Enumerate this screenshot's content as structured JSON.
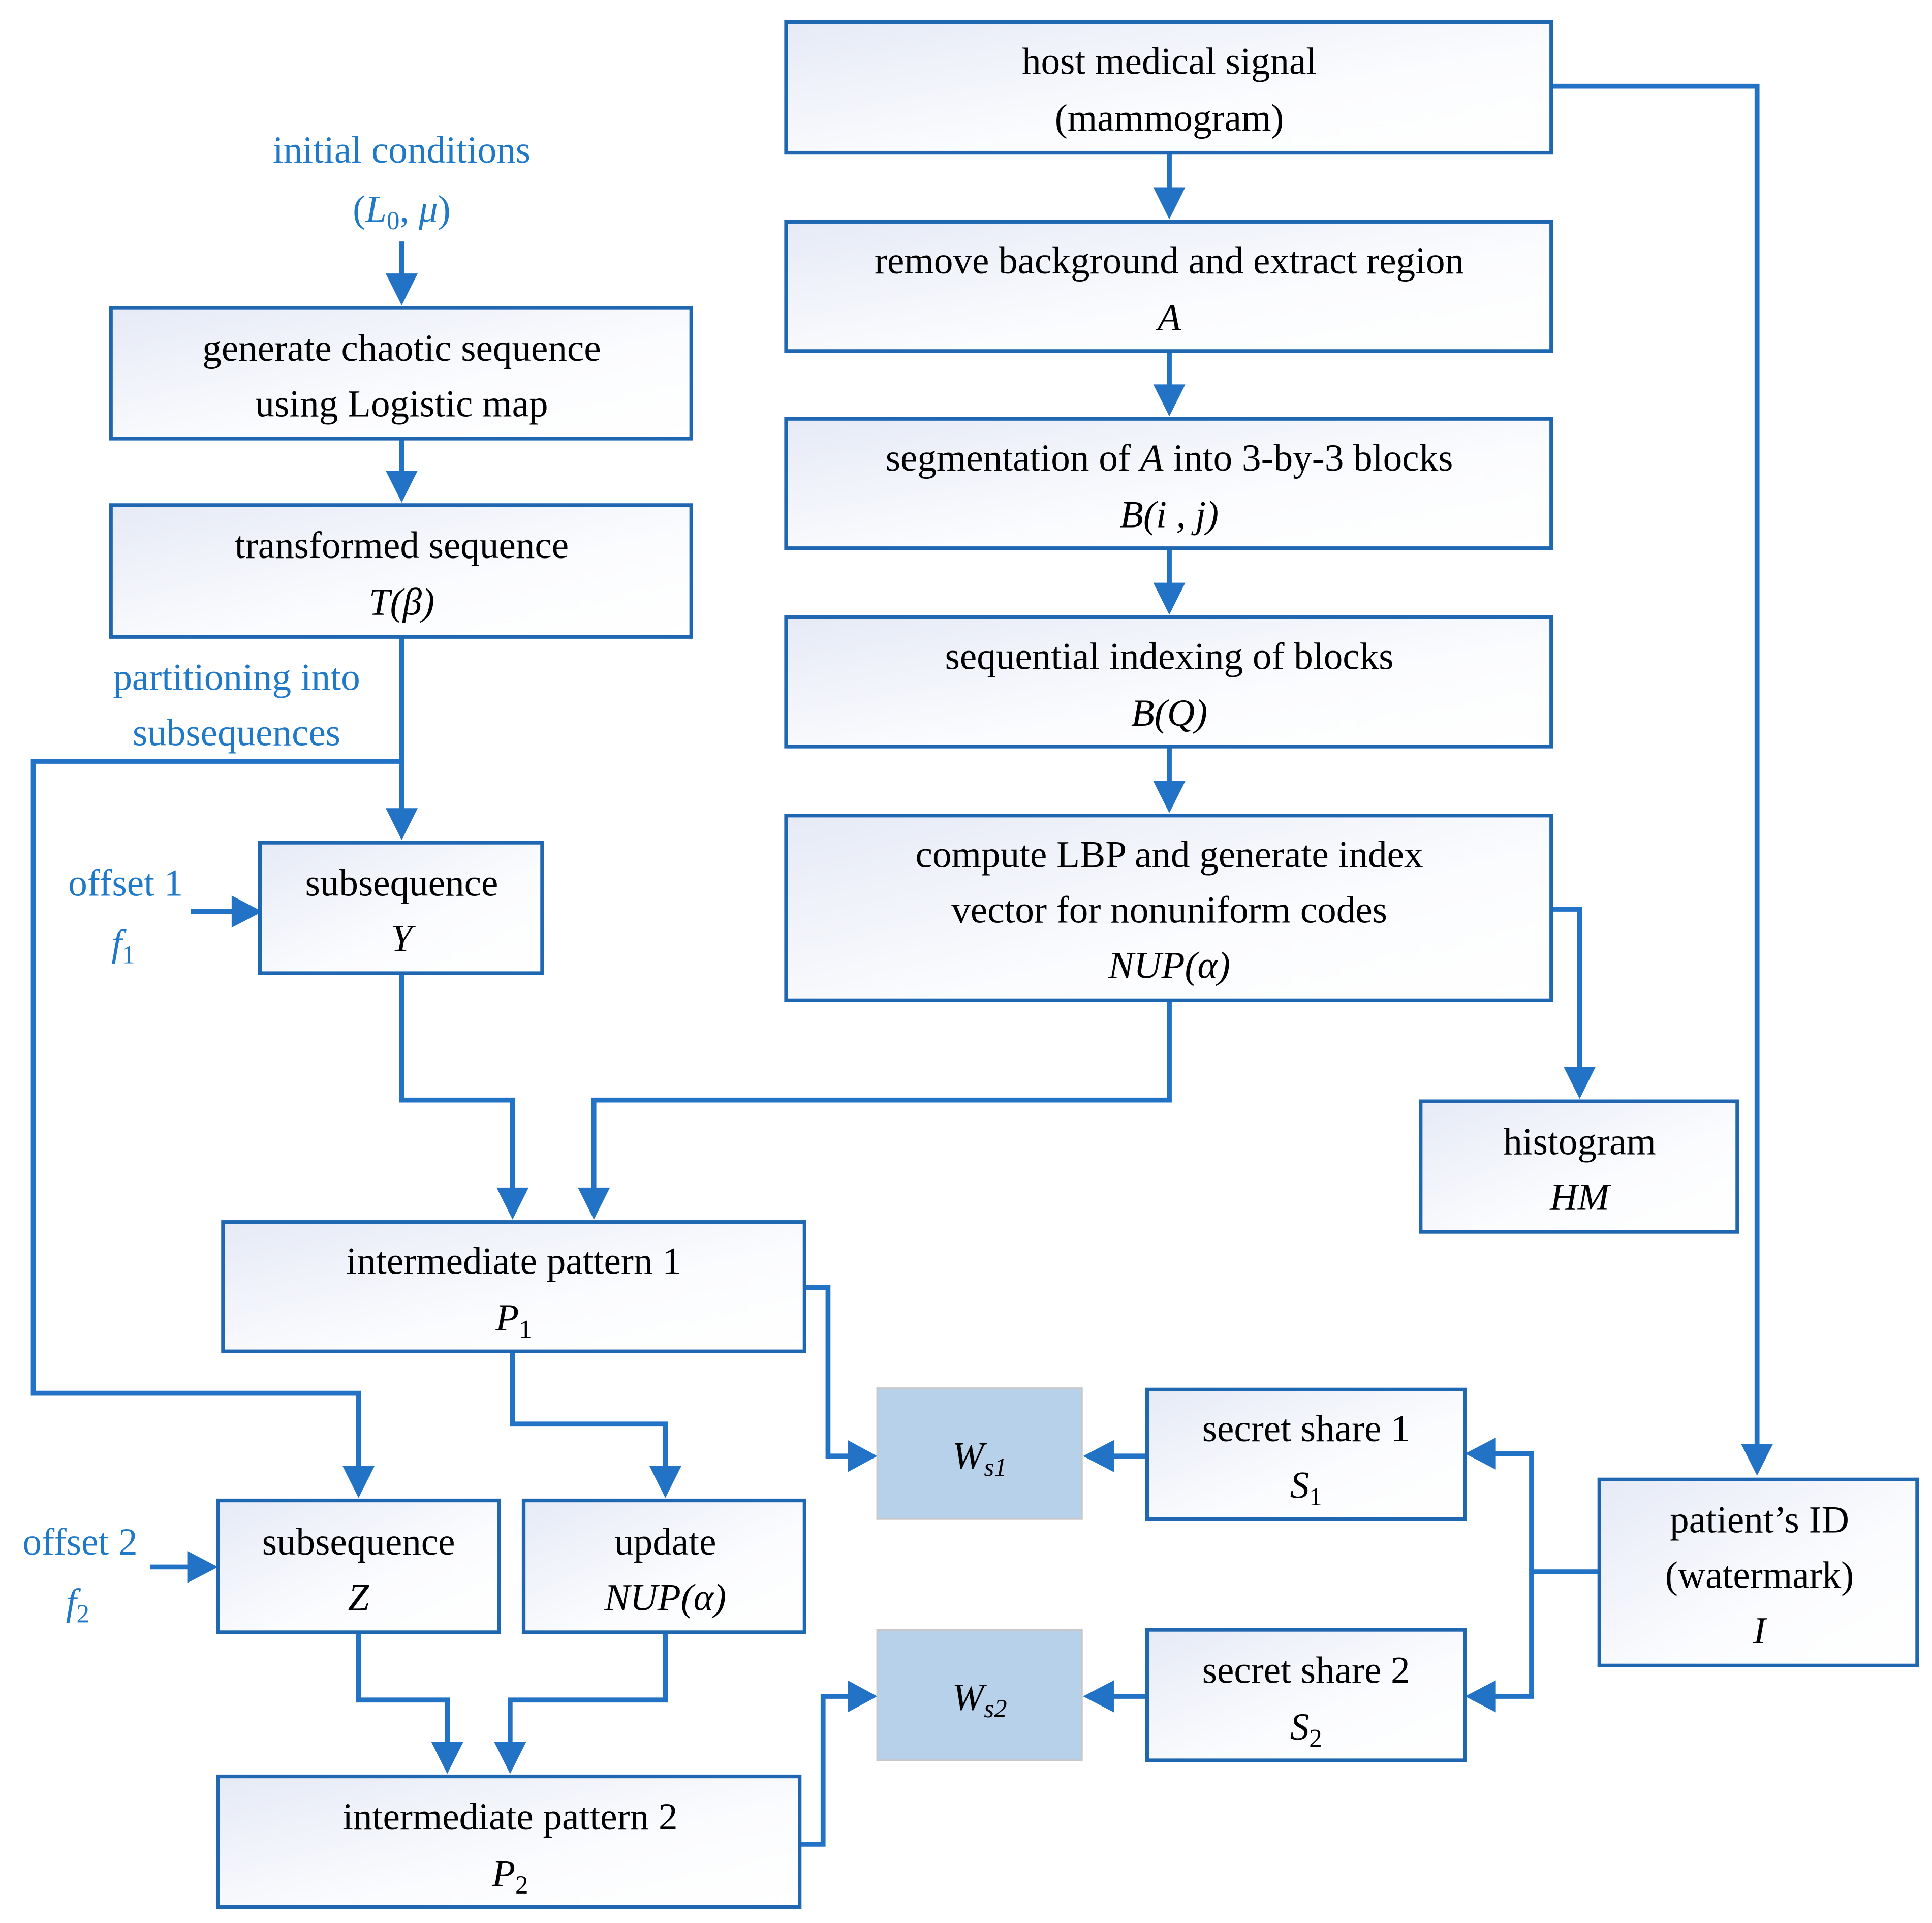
{
  "title": "Watermarking flowchart: chaotic sequence, LBP and secret sharing",
  "colors": {
    "line": "#2272c6",
    "box_border": "#1f67b1",
    "label_blue": "#1f78c8",
    "watermark_share_fill": "#b7d1ea"
  },
  "labels": {
    "initial_conditions": "initial conditions",
    "initial_params_open": "(",
    "initial_params_L": "L",
    "initial_params_L_sub": "0",
    "initial_params_sep": ", ",
    "initial_params_mu": "μ",
    "initial_params_close": ")",
    "partitioning_line1": "partitioning into",
    "partitioning_line2": "subsequences",
    "offset1": "offset 1",
    "offset1_sym": "f",
    "offset1_sub": "1",
    "offset2": "offset 2",
    "offset2_sym": "f",
    "offset2_sub": "2"
  },
  "boxes": {
    "chaotic": {
      "line1": "generate chaotic sequence",
      "line2": "using Logistic map"
    },
    "transformed": {
      "line1": "transformed sequence",
      "symbol": "T(β)"
    },
    "subseq_y": {
      "line1": "subsequence",
      "symbol": "Y"
    },
    "host": {
      "line1": "host medical signal",
      "line2": "(mammogram)"
    },
    "remove_bg": {
      "line1": "remove background and extract region",
      "symbol": "A"
    },
    "segmentation": {
      "line1_a": "segmentation of ",
      "line1_sym": "A",
      "line1_b": " into 3-by-3 blocks",
      "symbol": "B(i , j)"
    },
    "indexing": {
      "line1": "sequential indexing of blocks",
      "symbol": "B(Q)"
    },
    "lbp": {
      "line1": "compute LBP and generate index",
      "line2": "vector for nonuniform codes",
      "symbol": "NUP(α)"
    },
    "histogram": {
      "line1": "histogram",
      "symbol": "HM"
    },
    "pattern1": {
      "line1": "intermediate pattern 1",
      "symbol": "P",
      "sub": "1"
    },
    "subseq_z": {
      "line1": "subsequence",
      "symbol": "Z"
    },
    "update": {
      "line1": "update",
      "symbol": "NUP(α)"
    },
    "pattern2": {
      "line1": "intermediate pattern 2",
      "symbol": "P",
      "sub": "2"
    },
    "ws1": {
      "symbol": "W",
      "sub": "s1"
    },
    "ws2": {
      "symbol": "W",
      "sub": "s2"
    },
    "share1": {
      "line1": "secret share 1",
      "symbol": "S",
      "sub": "1"
    },
    "share2": {
      "line1": "secret share 2",
      "symbol": "S",
      "sub": "2"
    },
    "patient": {
      "line1": "patient’s ID",
      "line2": "(watermark)",
      "symbol": "I"
    }
  }
}
